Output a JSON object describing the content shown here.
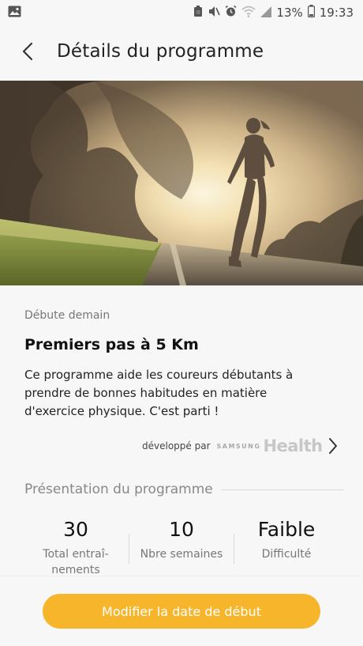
{
  "status_bar": {
    "battery_percent": "13%",
    "time": "19:33",
    "icons": [
      "image-icon",
      "battery-saver-icon",
      "mute-icon",
      "alarm-icon",
      "wifi-icon",
      "signal-icon",
      "battery-icon"
    ]
  },
  "header": {
    "title": "Détails du programme",
    "back_icon": "back-arrow-icon"
  },
  "hero": {
    "image_subject": "runner-at-sunrise"
  },
  "program": {
    "start_label": "Débute demain",
    "title": "Premiers pas à 5 Km",
    "description": "Ce programme aide les coureurs débutants à prendre de bonnes habitudes en matière d'exercice physique. C'est parti !",
    "developed_by_label": "développé par",
    "brand_prefix": "SAMSUNG",
    "brand_name": "Health"
  },
  "overview": {
    "section_title": "Présentation du programme",
    "stats": [
      {
        "value": "30",
        "label": "Total entraî-\nnements"
      },
      {
        "value": "10",
        "label": "Nbre semaines"
      },
      {
        "value": "Faible",
        "label": "Difficulté"
      }
    ]
  },
  "actions": {
    "cta_label": "Modifier la date de début"
  },
  "colors": {
    "accent": "#f7b52c",
    "background": "#f7f7f7"
  }
}
